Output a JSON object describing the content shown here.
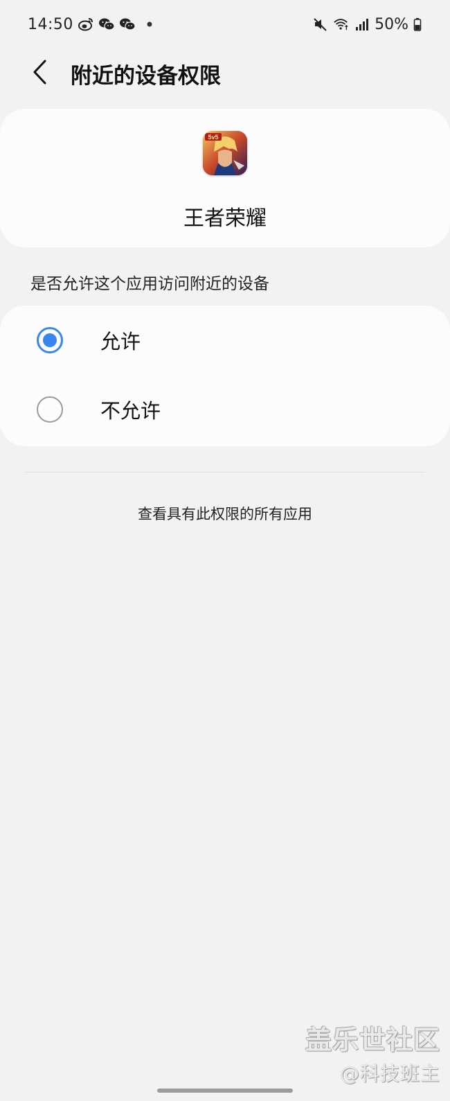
{
  "status_bar": {
    "time": "14:50",
    "battery": "50%",
    "left_icons": [
      "weibo-icon",
      "wechat-icon",
      "wechat-icon",
      "dot-icon"
    ],
    "right_icons": [
      "mute-icon",
      "wifi-icon",
      "signal-icon",
      "battery-icon"
    ]
  },
  "header": {
    "title": "附近的设备权限"
  },
  "app": {
    "name": "王者荣耀",
    "icon_badge": "5v5"
  },
  "question": "是否允许这个应用访问附近的设备",
  "options": [
    {
      "label": "允许",
      "selected": true
    },
    {
      "label": "不允许",
      "selected": false
    }
  ],
  "see_all_link": "查看具有此权限的所有应用",
  "watermark": {
    "main": "盖乐世社区",
    "sub": "@科技班主"
  },
  "colors": {
    "background": "#f2f2f2",
    "card": "#fcfcfc",
    "accent": "#3a86f0"
  }
}
